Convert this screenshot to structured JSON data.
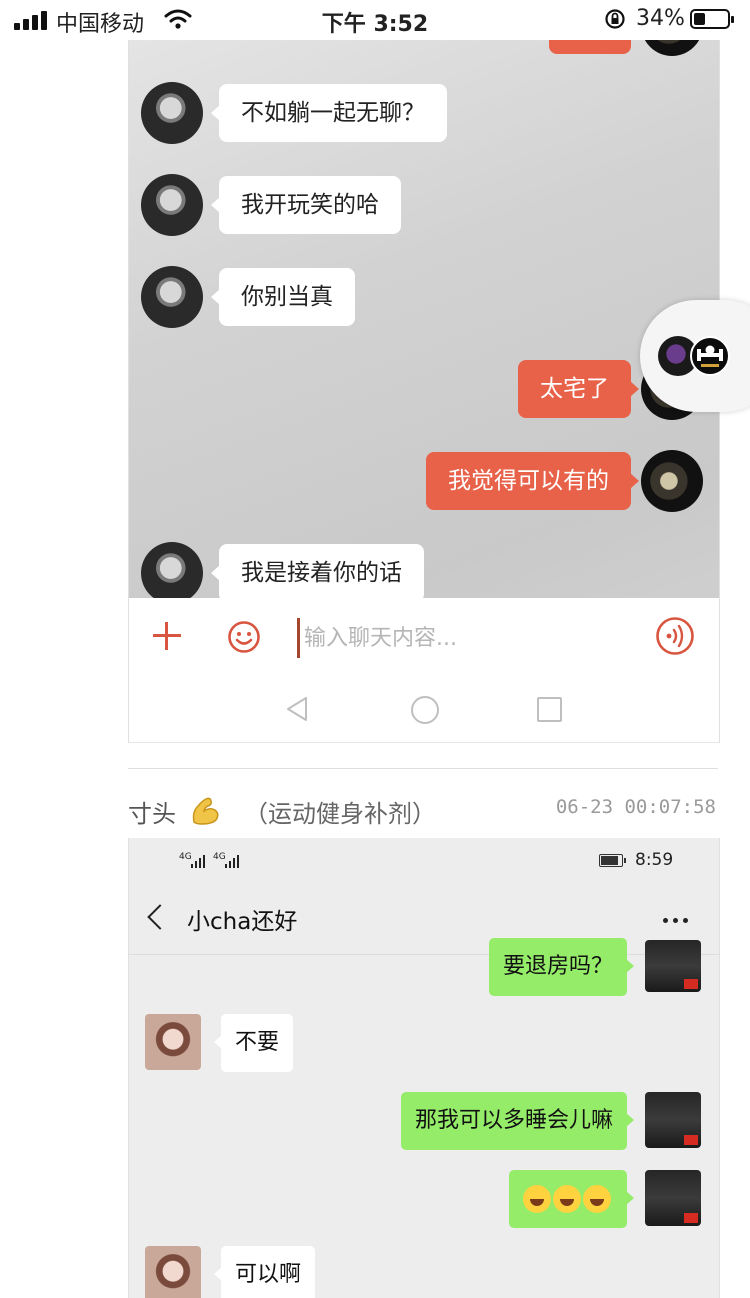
{
  "status_bar": {
    "carrier": "中国移动",
    "time": "下午 3:52",
    "battery_percent": "34%",
    "battery_level": 0.34
  },
  "chat1": {
    "messages": [
      {
        "side": "in",
        "text": "不如躺一起无聊？"
      },
      {
        "side": "in",
        "text": "我开玩笑的哈"
      },
      {
        "side": "in",
        "text": "你别当真"
      },
      {
        "side": "out",
        "text": "太宅了"
      },
      {
        "side": "out",
        "text": "我觉得可以有的"
      },
      {
        "side": "in",
        "text": "我是接着你的话"
      }
    ],
    "input_placeholder": "输入聊天内容...",
    "accent_color": "#e8624a"
  },
  "post": {
    "author": "寸头",
    "author_emoji": "flexed-biceps-icon",
    "tag": "（运动健身补剂）",
    "timestamp": "06-23 00:07:58"
  },
  "chat2": {
    "status_signal_1": "4G",
    "status_signal_2": "4G",
    "status_time": "8:59",
    "title": "小cha还好",
    "messages": [
      {
        "side": "out",
        "text": "要退房吗？"
      },
      {
        "side": "in",
        "text": "不要"
      },
      {
        "side": "out",
        "text": "那我可以多睡会儿嘛"
      },
      {
        "side": "out",
        "text": "",
        "emoji": "tears-of-joy-icon x3"
      },
      {
        "side": "in",
        "text": "可以啊"
      }
    ],
    "bubble_color": "#95ec69"
  }
}
